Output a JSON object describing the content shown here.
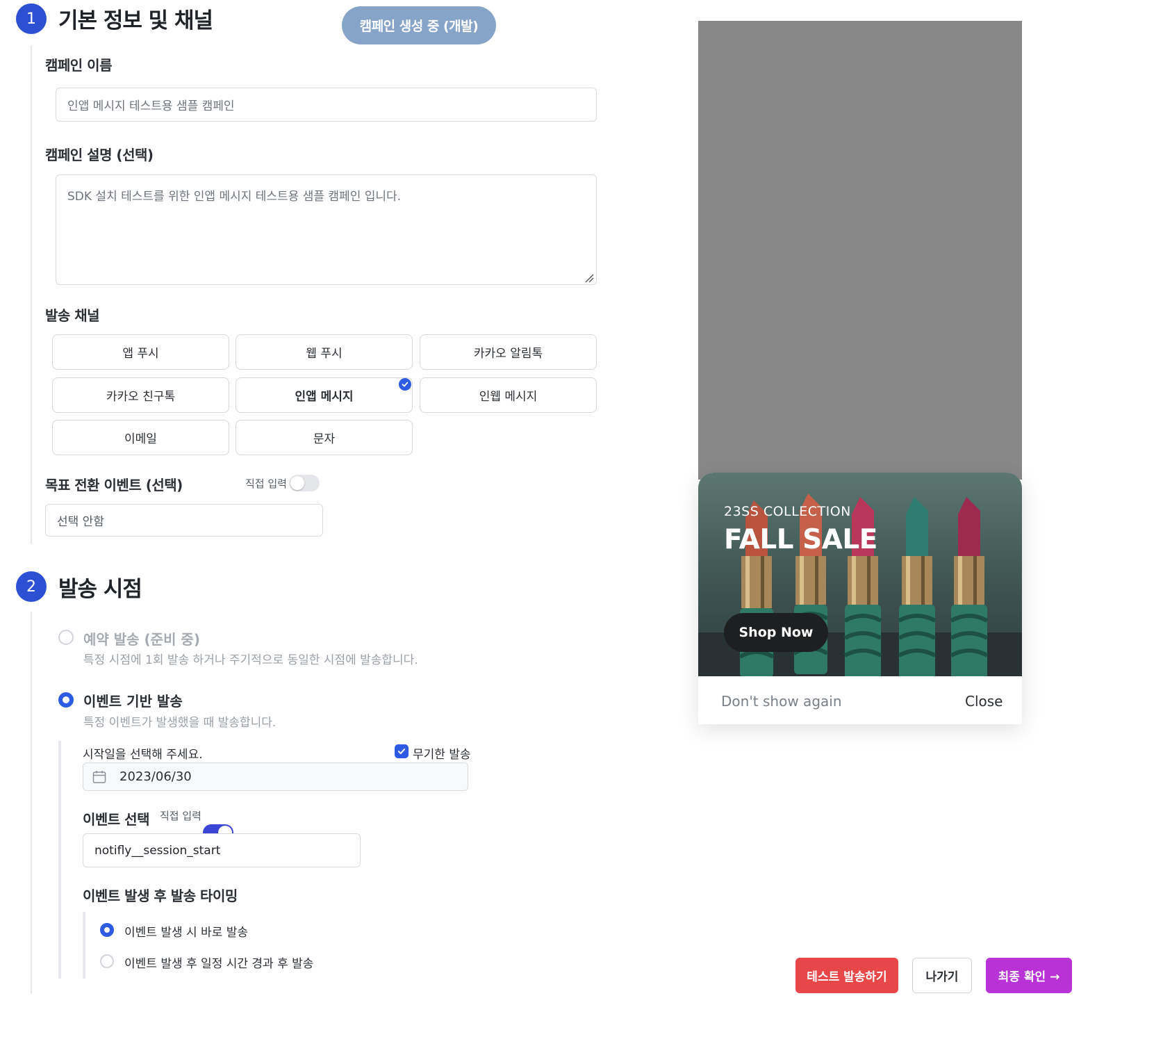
{
  "step1": {
    "number": "1",
    "title": "기본 정보 및 채널"
  },
  "status_pill": "캠페인 생성 중 (개발)",
  "campaign_name": {
    "label": "캠페인 이름",
    "placeholder": "인앱 메시지 테스트용 샘플 캠페인"
  },
  "campaign_desc": {
    "label": "캠페인 설명 (선택)",
    "placeholder": "SDK 설치 테스트를 위한 인앱 메시지 테스트용 샘플 캠페인 입니다."
  },
  "channels": {
    "label": "발송 채널",
    "items": [
      {
        "label": "앱 푸시",
        "selected": false
      },
      {
        "label": "웹 푸시",
        "selected": false
      },
      {
        "label": "카카오 알림톡",
        "selected": false
      },
      {
        "label": "카카오 친구톡",
        "selected": false
      },
      {
        "label": "인앱 메시지",
        "selected": true
      },
      {
        "label": "인웹 메시지",
        "selected": false
      },
      {
        "label": "이메일",
        "selected": false
      },
      {
        "label": "문자",
        "selected": false
      }
    ]
  },
  "goal_event": {
    "label": "목표 전환 이벤트 (선택)",
    "toggle_label": "직접 입력",
    "toggle_on": false,
    "select_value": "선택 안함"
  },
  "step2": {
    "number": "2",
    "title": "발송 시점"
  },
  "schedule": {
    "title": "예약 발송 (준비 중)",
    "desc": "특정 시점에 1회 발송 하거나 주기적으로 동일한 시점에 발송합니다.",
    "selected": false
  },
  "event_based": {
    "title": "이벤트 기반 발송",
    "desc": "특정 이벤트가 발생했을 때 발송합니다.",
    "selected": true
  },
  "start_date": {
    "label": "시작일을 선택해 주세요.",
    "unlimited_label": "무기한 발송",
    "unlimited_checked": true,
    "value": "2023/06/30"
  },
  "event_select": {
    "label": "이벤트 선택",
    "toggle_label": "직접 입력",
    "toggle_on": true,
    "value": "notifly__session_start"
  },
  "timing": {
    "label": "이벤트 발생 후 발송 타이밍",
    "options": [
      {
        "label": "이벤트 발생 시 바로 발송",
        "selected": true
      },
      {
        "label": "이벤트 발생 후 일정 시간 경과 후 발송",
        "selected": false
      }
    ]
  },
  "preview": {
    "subtitle": "23SS COLLECTION",
    "title": "FALL SALE",
    "cta": "Shop Now",
    "dont_show": "Don't show again",
    "close": "Close"
  },
  "actions": {
    "test_send": "테스트 발송하기",
    "exit": "나가기",
    "confirm": "최종 확인 →"
  },
  "colors": {
    "accent": "#2d5be3",
    "step": "#2d4fd2",
    "danger": "#e8474a",
    "confirm": "#b832d6",
    "pill": "#86a4c8"
  }
}
